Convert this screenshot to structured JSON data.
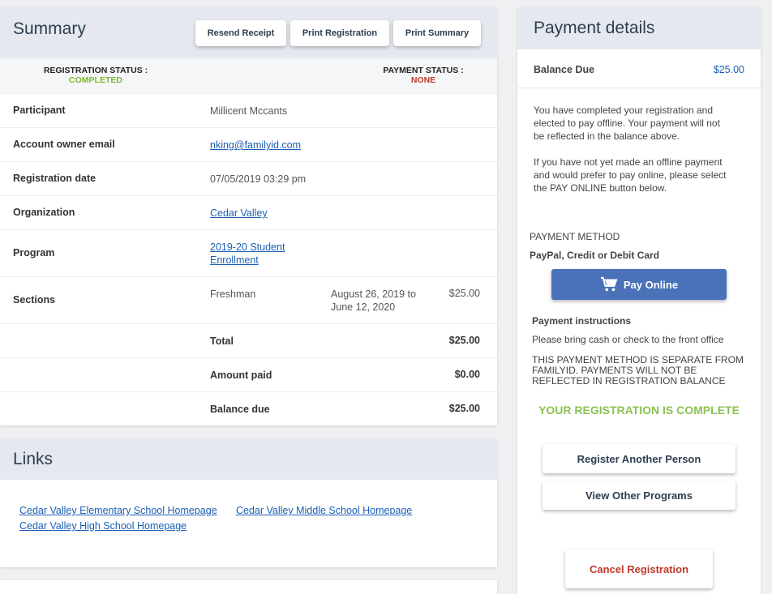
{
  "summary": {
    "title": "Summary",
    "buttons": {
      "resend": "Resend Receipt",
      "print_registration": "Print Registration",
      "print_summary": "Print Summary"
    },
    "registration_status_label": "REGISTRATION STATUS :",
    "registration_status_value": "COMPLETED",
    "payment_status_label": "PAYMENT STATUS :",
    "payment_status_value": "NONE",
    "rows": {
      "participant": {
        "label": "Participant",
        "value": "Millicent Mccants"
      },
      "email": {
        "label": "Account owner email",
        "value": "nking@familyid.com"
      },
      "date": {
        "label": "Registration date",
        "value": "07/05/2019 03:29 pm"
      },
      "organization": {
        "label": "Organization",
        "value": "Cedar Valley"
      },
      "program": {
        "label": "Program",
        "value_line1": "2019-20 Student",
        "value_line2": "Enrollment"
      },
      "sections": {
        "label": "Sections",
        "name": "Freshman",
        "dates_line1": "August 26, 2019 to",
        "dates_line2": "June 12, 2020",
        "amount": "$25.00"
      },
      "total": {
        "label": "Total",
        "amount": "$25.00"
      },
      "paid": {
        "label": "Amount paid",
        "amount": "$0.00"
      },
      "balance": {
        "label": "Balance due",
        "amount": "$25.00"
      }
    }
  },
  "links": {
    "title": "Links",
    "items": [
      "Cedar Valley Elementary School Homepage",
      "Cedar Valley Middle School Homepage",
      "Cedar Valley High School Homepage"
    ]
  },
  "payment": {
    "title": "Payment details",
    "balance_label": "Balance Due",
    "balance_value": "$25.00",
    "msg1_l1": "You have completed your registration and",
    "msg1_l2": "elected to pay offline. Your payment will not",
    "msg1_l3": "be reflected in the balance above.",
    "msg2_l1": "If you have not yet made an offline payment",
    "msg2_l2": "and would prefer to pay online, please select",
    "msg2_l3": "the PAY ONLINE button below.",
    "method_label": "PAYMENT METHOD",
    "method_value": "PayPal, Credit or Debit Card",
    "pay_button": "Pay Online",
    "instructions_label": "Payment instructions",
    "instructions_text": "Please bring cash or check to the front office",
    "notice_l1": "THIS PAYMENT METHOD IS SEPARATE FROM",
    "notice_l2": "FAMILYID. PAYMENTS WILL NOT BE",
    "notice_l3": "REFLECTED IN REGISTRATION BALANCE",
    "complete_msg": "YOUR REGISTRATION IS COMPLETE",
    "register_another": "Register Another Person",
    "view_programs": "View Other Programs",
    "cancel": "Cancel Registration",
    "colors": {
      "accent": "#4a72b8",
      "success": "#8cc152",
      "danger": "#c0392b",
      "link": "#1a5fb4"
    }
  }
}
